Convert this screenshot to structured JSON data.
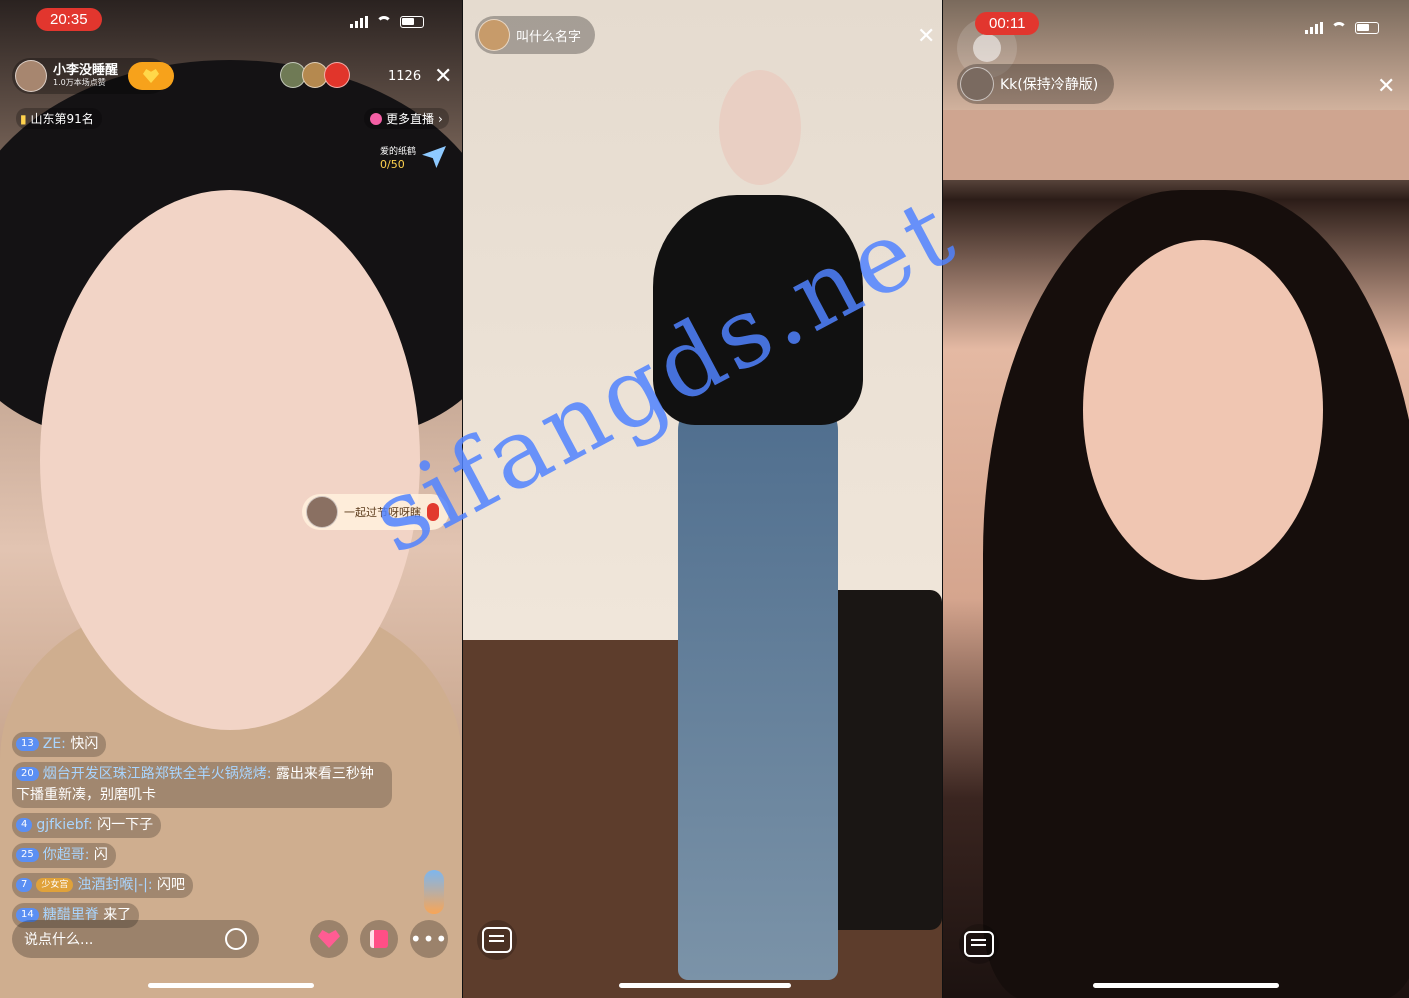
{
  "panel1": {
    "status_time": "20:35",
    "host_name": "小李没睡醒",
    "host_likes": "1.0万本场点赞",
    "viewer_count": "1126",
    "rank": "山东第91名",
    "more_live": "更多直播",
    "crane_label": "爱的纸鹤",
    "crane_count": "0/50",
    "float_banner": "一起过节呀呀瞎",
    "chat": [
      {
        "level": "13",
        "user": "ZE:",
        "text": "快闪"
      },
      {
        "level": "20",
        "user": "烟台开发区珠江路郑铁全羊火锅烧烤:",
        "text": "露出来看三秒钟下播重新凑，别磨叽卡"
      },
      {
        "level": "4",
        "user": "gjfkiebf:",
        "text": "闪一下子"
      },
      {
        "level": "25",
        "user": "你超哥:",
        "text": "闪"
      },
      {
        "level": "7",
        "tag": "少女宫",
        "user": "浊酒封喉|-|:",
        "text": "闪吧"
      },
      {
        "level": "14",
        "user": "糖醋里脊",
        "text": "来了"
      }
    ],
    "comment_placeholder": "说点什么..."
  },
  "panel2": {
    "host_name": "叫什么名字"
  },
  "panel3": {
    "status_time": "00:11",
    "host_name": "Kk(保持冷静版)"
  },
  "watermark": "sifangds.net"
}
